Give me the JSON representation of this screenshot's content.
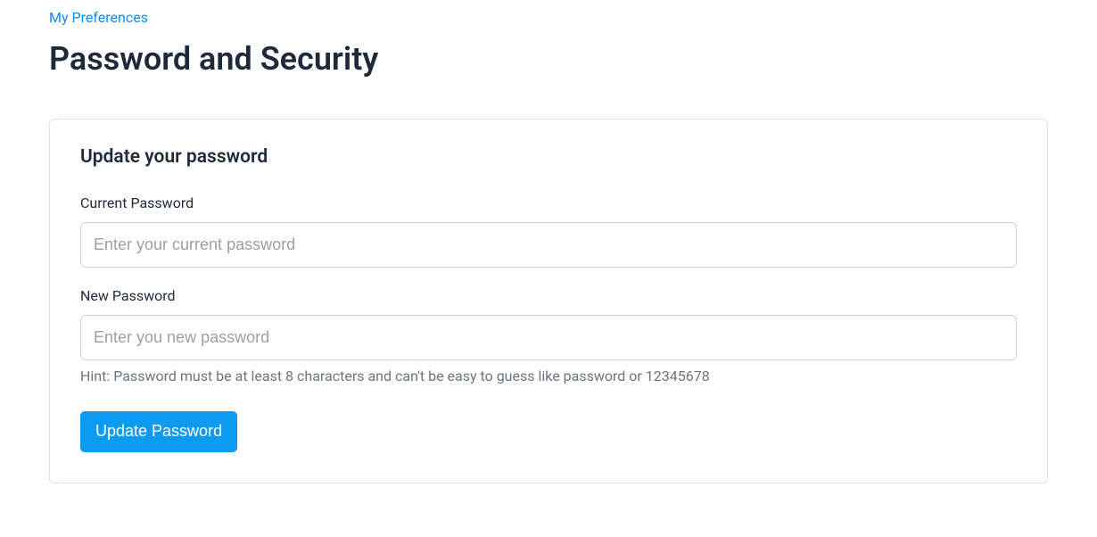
{
  "breadcrumb": {
    "label": "My Preferences"
  },
  "page": {
    "title": "Password and Security"
  },
  "card": {
    "title": "Update your password",
    "current_password": {
      "label": "Current Password",
      "placeholder": "Enter your current password",
      "value": ""
    },
    "new_password": {
      "label": "New Password",
      "placeholder": "Enter you new password",
      "value": ""
    },
    "hint": "Hint: Password must be at least 8 characters and can't be easy to guess like password or 12345678",
    "submit_label": "Update Password"
  }
}
